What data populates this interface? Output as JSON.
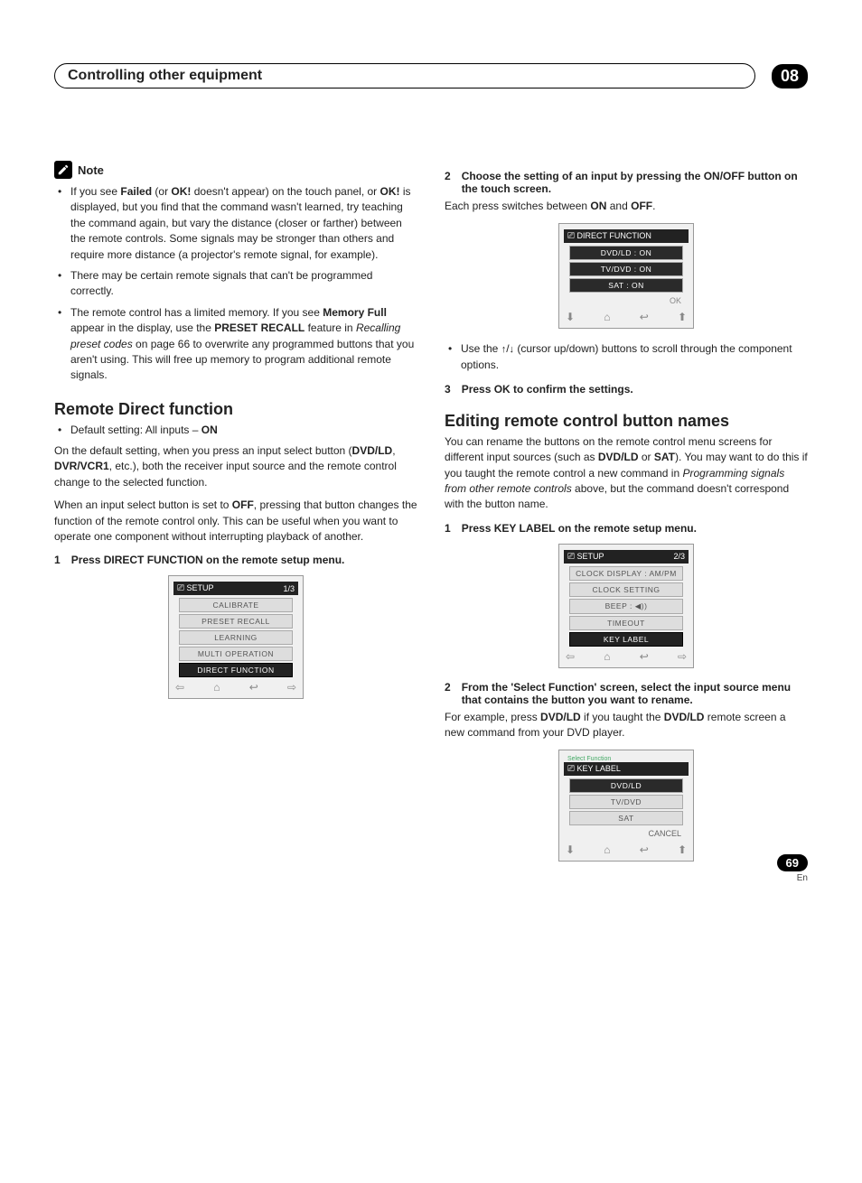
{
  "header": {
    "title": "Controlling other equipment",
    "chapter": "08"
  },
  "note": {
    "label": "Note",
    "items": [
      "If you see <b>Failed</b> (or <b>OK!</b> doesn't appear) on the touch panel, or <b>OK!</b> is displayed, but you find that the command wasn't learned, try teaching the command again, but vary the distance (closer or farther) between the remote controls. Some signals may be stronger than others and require more distance (a projector's remote signal, for example).",
      "There may be certain remote signals that can't be programmed correctly.",
      "The remote control has a limited memory. If you see <b>Memory Full</b> appear in the display, use the <b>PRESET RECALL</b> feature in <i>Recalling preset codes</i> on page 66 to overwrite any programmed buttons that you aren't using. This will free up memory to program additional remote signals."
    ]
  },
  "section1": {
    "heading": "Remote Direct function",
    "default_bullet": "Default setting: All inputs – <b>ON</b>",
    "para1": "On the default setting, when you press an input select button (<b>DVD/LD</b>, <b>DVR/VCR1</b>, etc.), both the receiver input source and the remote control change to the selected function.",
    "para2": "When an input select button is set to <b>OFF</b>, pressing that button changes the function of the remote control only. This can be useful when you want to operate one component without interrupting playback of another.",
    "step1_num": "1",
    "step1_text": "Press DIRECT FUNCTION on the remote setup menu."
  },
  "remote1": {
    "title": "SETUP",
    "page": "1/3",
    "items": [
      "CALIBRATE",
      "PRESET RECALL",
      "LEARNING",
      "MULTI OPERATION"
    ],
    "highlight": "DIRECT FUNCTION"
  },
  "right": {
    "step2_num": "2",
    "step2_text": "Choose the setting of an input by pressing the ON/OFF button on the touch screen.",
    "step2_sub": "Each press switches between <b>ON</b> and <b>OFF</b>.",
    "remote_df": {
      "title": "DIRECT FUNCTION",
      "items": [
        "DVD/LD : ON",
        "TV/DVD : ON",
        "SAT : ON"
      ],
      "ok": "OK"
    },
    "cursor_bullet": "Use the <span class='arrow-glyph'>↑</span>/<span class='arrow-glyph'>↓</span> (cursor up/down) buttons to scroll through the component options.",
    "step3_num": "3",
    "step3_text": "Press OK to confirm the settings."
  },
  "section2": {
    "heading": "Editing remote control button names",
    "para1": "You can rename the buttons on the remote control menu screens for different input sources (such as <b>DVD/LD</b> or <b>SAT</b>). You may want to do this if you taught the remote control a new command in <i>Programming signals from other remote controls</i> above, but the command doesn't correspond with the button name.",
    "step1_num": "1",
    "step1_text": "Press KEY LABEL on the remote setup menu.",
    "remote2": {
      "title": "SETUP",
      "page": "2/3",
      "items": [
        "CLOCK DISPLAY : AM/PM",
        "CLOCK SETTING",
        "BEEP :  ◀))",
        "TIMEOUT"
      ],
      "highlight": "KEY LABEL"
    },
    "step2_num": "2",
    "step2_text": "From the 'Select Function' screen, select the input source menu that contains the button you want to rename.",
    "step2_sub": "For example, press <b>DVD/LD</b> if you taught the <b>DVD/LD</b> remote screen a new command from your DVD player.",
    "remote3": {
      "subtitle": "Select Function",
      "title": "KEY LABEL",
      "items": [
        "DVD/LD",
        "TV/DVD",
        "SAT"
      ],
      "cancel": "CANCEL"
    }
  },
  "footer": {
    "page": "69",
    "lang": "En"
  }
}
